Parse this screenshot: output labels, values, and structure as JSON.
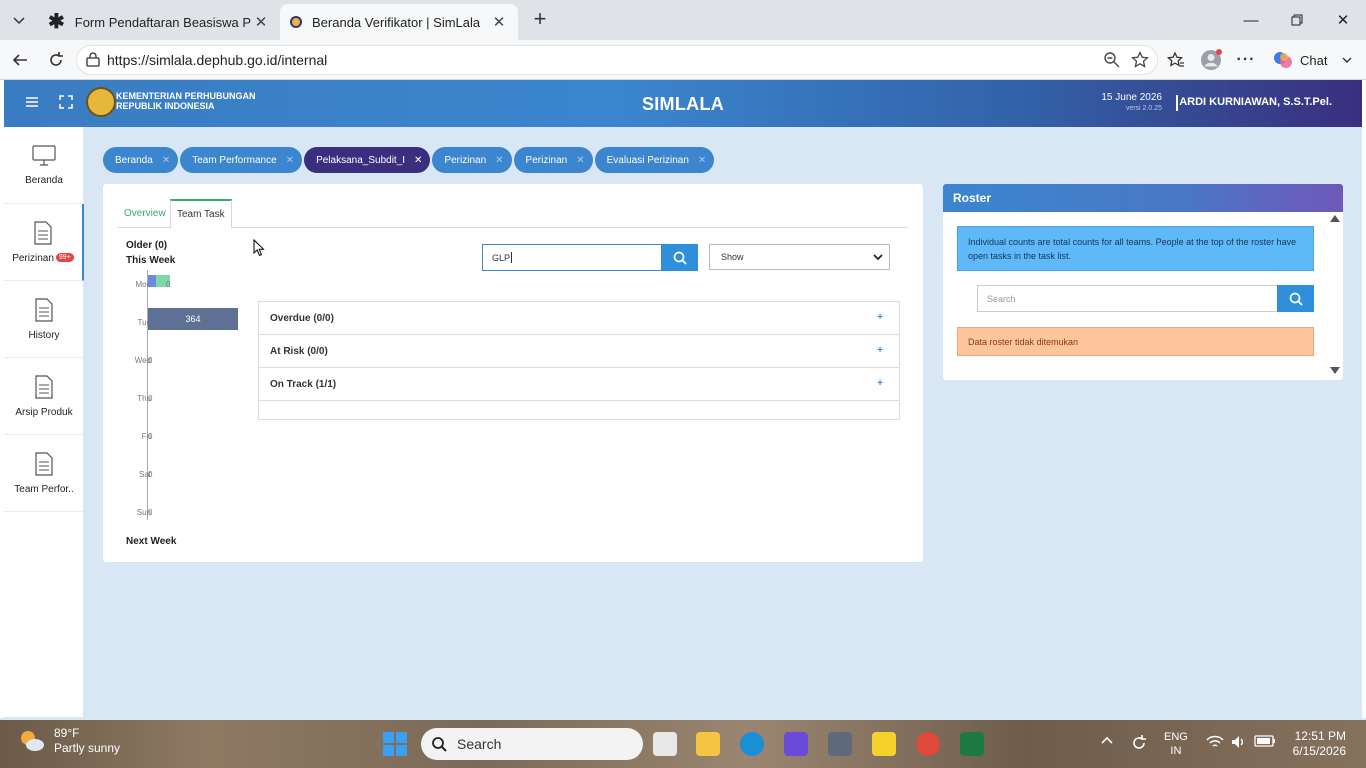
{
  "browser": {
    "tabs": [
      {
        "title": "Form Pendaftaran Beasiswa Progra",
        "active": false
      },
      {
        "title": "Beranda Verifikator | SimLala",
        "active": true
      }
    ],
    "url": "https://simlala.dephub.go.id/internal",
    "chat_label": "Chat"
  },
  "app": {
    "org_line1": "KEMENTERIAN PERHUBUNGAN",
    "org_line2": "REPUBLIK INDONESIA",
    "title": "SIMLALA",
    "date": "15 June 2026",
    "version": "versi 2.0.25",
    "user": "ARDI KURNIAWAN, S.S.T.Pel."
  },
  "sidebar": {
    "items": [
      {
        "label": "Beranda",
        "icon": "monitor-icon"
      },
      {
        "label": "Perizinan",
        "icon": "document-icon",
        "badge": "99+"
      },
      {
        "label": "History",
        "icon": "document-icon"
      },
      {
        "label": "Arsip Produk",
        "icon": "document-icon"
      },
      {
        "label": "Team Perfor..",
        "icon": "document-icon"
      }
    ]
  },
  "page_tabs": [
    {
      "label": "Beranda",
      "active": false
    },
    {
      "label": "Team Performance",
      "active": false
    },
    {
      "label": "Pelaksana_Subdit_I",
      "active": true
    },
    {
      "label": "Perizinan",
      "active": false
    },
    {
      "label": "Perizinan",
      "active": false
    },
    {
      "label": "Evaluasi Perizinan",
      "active": false
    }
  ],
  "main": {
    "subtabs": [
      "Overview",
      "Team Task"
    ],
    "week": {
      "older": "Older (0)",
      "this_week": "This Week",
      "next_week": "Next Week",
      "days": [
        {
          "name": "Mon",
          "value": 0,
          "shown_value": "0"
        },
        {
          "name": "Tue",
          "value": 364,
          "shown_value": "0",
          "bar_label": "364"
        },
        {
          "name": "Wed",
          "value": 0,
          "shown_value": "0"
        },
        {
          "name": "Thu",
          "value": 0,
          "shown_value": "0"
        },
        {
          "name": "Fri",
          "value": 0,
          "shown_value": "0"
        },
        {
          "name": "Sat",
          "value": 0,
          "shown_value": "0"
        },
        {
          "name": "Sun",
          "value": 0,
          "shown_value": "0"
        }
      ]
    },
    "search_value": "GLP",
    "show_select": "Show",
    "sections": [
      {
        "label": "Overdue (0/0)"
      },
      {
        "label": "At Risk (0/0)"
      },
      {
        "label": "On Track (1/1)"
      }
    ]
  },
  "roster": {
    "title": "Roster",
    "info": "Individual counts are total counts for all teams. People at the top of the roster have open tasks in the task list.",
    "search_placeholder": "Search",
    "empty_message": "Data roster tidak ditemukan"
  },
  "taskbar": {
    "temperature": "89°F",
    "weather": "Partly sunny",
    "search_placeholder": "Search",
    "lang1": "ENG",
    "lang2": "IN",
    "time": "12:51 PM",
    "date": "6/15/2026"
  },
  "colors": {
    "accent": "#3b86cf",
    "active_tab": "#3a2f7e",
    "success": "#3aa96a",
    "warning_bg": "#fcc59c"
  }
}
